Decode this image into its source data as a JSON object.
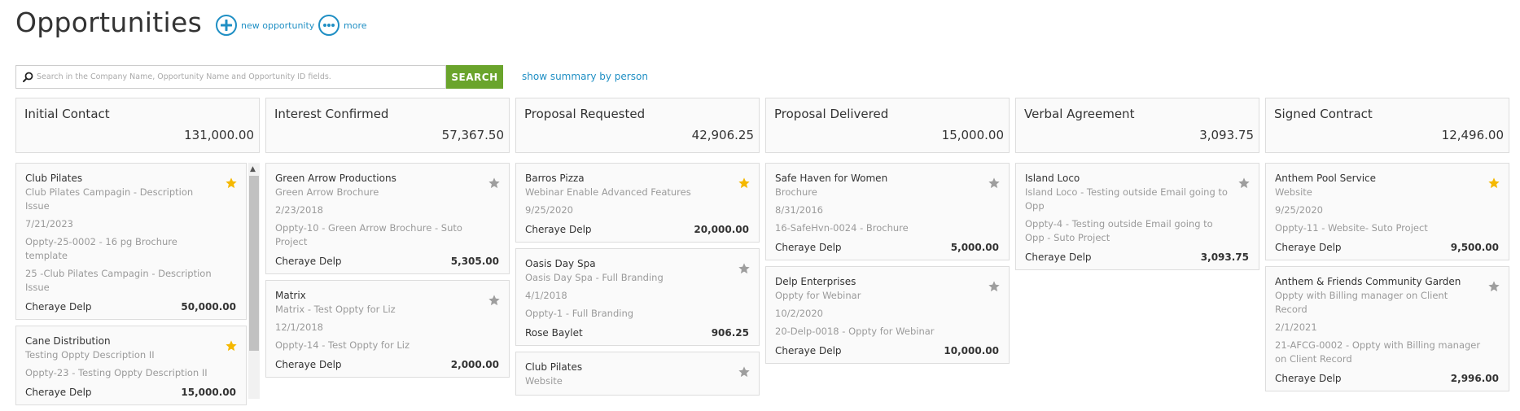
{
  "header": {
    "title": "Opportunities",
    "new_label": "new opportunity",
    "more_label": "more"
  },
  "search": {
    "placeholder": "Search in the Company Name, Opportunity Name and Opportunity ID fields.",
    "button_label": "SEARCH",
    "summary_link": "show summary by person"
  },
  "colors": {
    "accent": "#1f8fc4",
    "search_btn": "#6aa42c",
    "star_on": "#f5b800",
    "star_off": "#9e9e9e"
  },
  "columns": [
    {
      "stage": "Initial Contact",
      "total": "131,000.00",
      "cards": [
        {
          "company": "Club Pilates",
          "lines": [
            "Club Pilates Campagin - Description Issue",
            "7/21/2023",
            "Oppty-25-0002 - 16 pg Brochure template",
            "25 -Club Pilates Campagin - Description Issue"
          ],
          "owner": "Cheraye Delp",
          "amount": "50,000.00",
          "starred": true
        },
        {
          "company": "Cane Distribution",
          "lines": [
            "Testing Oppty Description II",
            "Oppty-23 - Testing Oppty Description II"
          ],
          "owner": "Cheraye Delp",
          "amount": "15,000.00",
          "starred": true
        }
      ]
    },
    {
      "stage": "Interest Confirmed",
      "total": "57,367.50",
      "cards": [
        {
          "company": "Green Arrow Productions",
          "lines": [
            "Green Arrow Brochure",
            "2/23/2018",
            "Oppty-10 - Green Arrow Brochure - Suto Project"
          ],
          "owner": "Cheraye Delp",
          "amount": "5,305.00",
          "starred": false
        },
        {
          "company": "Matrix",
          "lines": [
            "Matrix - Test Oppty for Liz",
            "12/1/2018",
            "Oppty-14 - Test Oppty for Liz"
          ],
          "owner": "Cheraye Delp",
          "amount": "2,000.00",
          "starred": false
        }
      ]
    },
    {
      "stage": "Proposal Requested",
      "total": "42,906.25",
      "cards": [
        {
          "company": "Barros Pizza",
          "lines": [
            "Webinar Enable Advanced Features",
            "9/25/2020"
          ],
          "owner": "Cheraye Delp",
          "amount": "20,000.00",
          "starred": true
        },
        {
          "company": "Oasis Day Spa",
          "lines": [
            "Oasis Day Spa - Full Branding",
            "4/1/2018",
            "Oppty-1 - Full Branding"
          ],
          "owner": "Rose Baylet",
          "amount": "906.25",
          "starred": false
        },
        {
          "company": "Club Pilates",
          "lines": [
            "Website"
          ],
          "owner": "",
          "amount": "",
          "starred": false
        }
      ]
    },
    {
      "stage": "Proposal Delivered",
      "total": "15,000.00",
      "cards": [
        {
          "company": "Safe Haven for Women",
          "lines": [
            "Brochure",
            "8/31/2016",
            "16-SafeHvn-0024 - Brochure"
          ],
          "owner": "Cheraye Delp",
          "amount": "5,000.00",
          "starred": false
        },
        {
          "company": "Delp Enterprises",
          "lines": [
            "Oppty for Webinar",
            "10/2/2020",
            "20-Delp-0018 - Oppty for Webinar"
          ],
          "owner": "Cheraye Delp",
          "amount": "10,000.00",
          "starred": false
        }
      ]
    },
    {
      "stage": "Verbal Agreement",
      "total": "3,093.75",
      "cards": [
        {
          "company": "Island Loco",
          "lines": [
            "Island Loco - Testing outside Email going to Opp",
            "Oppty-4 - Testing outside Email going to Opp - Suto Project"
          ],
          "owner": "Cheraye Delp",
          "amount": "3,093.75",
          "starred": false
        }
      ]
    },
    {
      "stage": "Signed Contract",
      "total": "12,496.00",
      "cards": [
        {
          "company": "Anthem Pool Service",
          "lines": [
            "Website",
            "9/25/2020",
            "Oppty-11 - Website- Suto Project"
          ],
          "owner": "Cheraye Delp",
          "amount": "9,500.00",
          "starred": true
        },
        {
          "company": "Anthem & Friends Community Garden",
          "lines": [
            "Oppty with Billing manager on Client Record",
            "2/1/2021",
            "21-AFCG-0002 - Oppty with Billing manager on Client Record"
          ],
          "owner": "Cheraye Delp",
          "amount": "2,996.00",
          "starred": false
        }
      ]
    }
  ]
}
